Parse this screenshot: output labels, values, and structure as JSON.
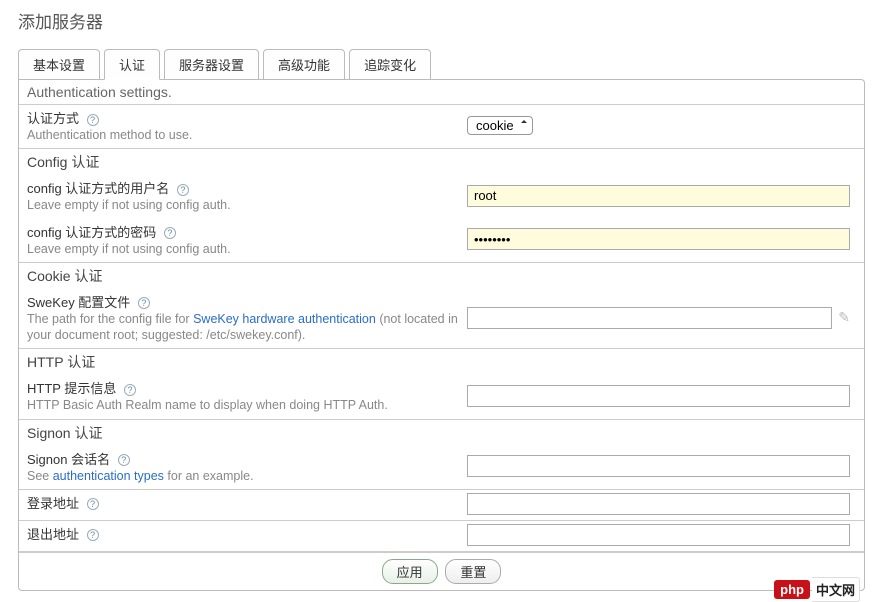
{
  "page_title": "添加服务器",
  "tabs": {
    "basic": "基本设置",
    "auth": "认证",
    "server": "服务器设置",
    "advanced": "高级功能",
    "tracking": "追踪变化"
  },
  "subhead": "Authentication settings.",
  "auth_method": {
    "label": "认证方式",
    "desc": "Authentication method to use.",
    "selected": "cookie"
  },
  "sections": {
    "config": "Config 认证",
    "cookie": "Cookie 认证",
    "http": "HTTP 认证",
    "signon": "Signon 认证"
  },
  "config_user": {
    "label": "config 认证方式的用户名",
    "desc": "Leave empty if not using config auth.",
    "value": "root"
  },
  "config_pass": {
    "label": "config 认证方式的密码",
    "desc": "Leave empty if not using config auth.",
    "value": "••••••••"
  },
  "swekey": {
    "label": "SweKey 配置文件",
    "desc_pre": "The path for the config file for ",
    "desc_link": "SweKey hardware authentication",
    "desc_post": " (not located in your document root; suggested: /etc/swekey.conf).",
    "value": ""
  },
  "http_realm": {
    "label": "HTTP 提示信息",
    "desc": "HTTP Basic Auth Realm name to display when doing HTTP Auth.",
    "value": ""
  },
  "signon_session": {
    "label": "Signon 会话名",
    "desc_pre": "See ",
    "desc_link": "authentication types",
    "desc_post": " for an example.",
    "value": ""
  },
  "login_url": {
    "label": "登录地址",
    "value": ""
  },
  "logout_url": {
    "label": "退出地址",
    "value": ""
  },
  "buttons": {
    "apply": "应用",
    "reset": "重置"
  },
  "brand": {
    "badge": "php",
    "text": "中文网"
  }
}
